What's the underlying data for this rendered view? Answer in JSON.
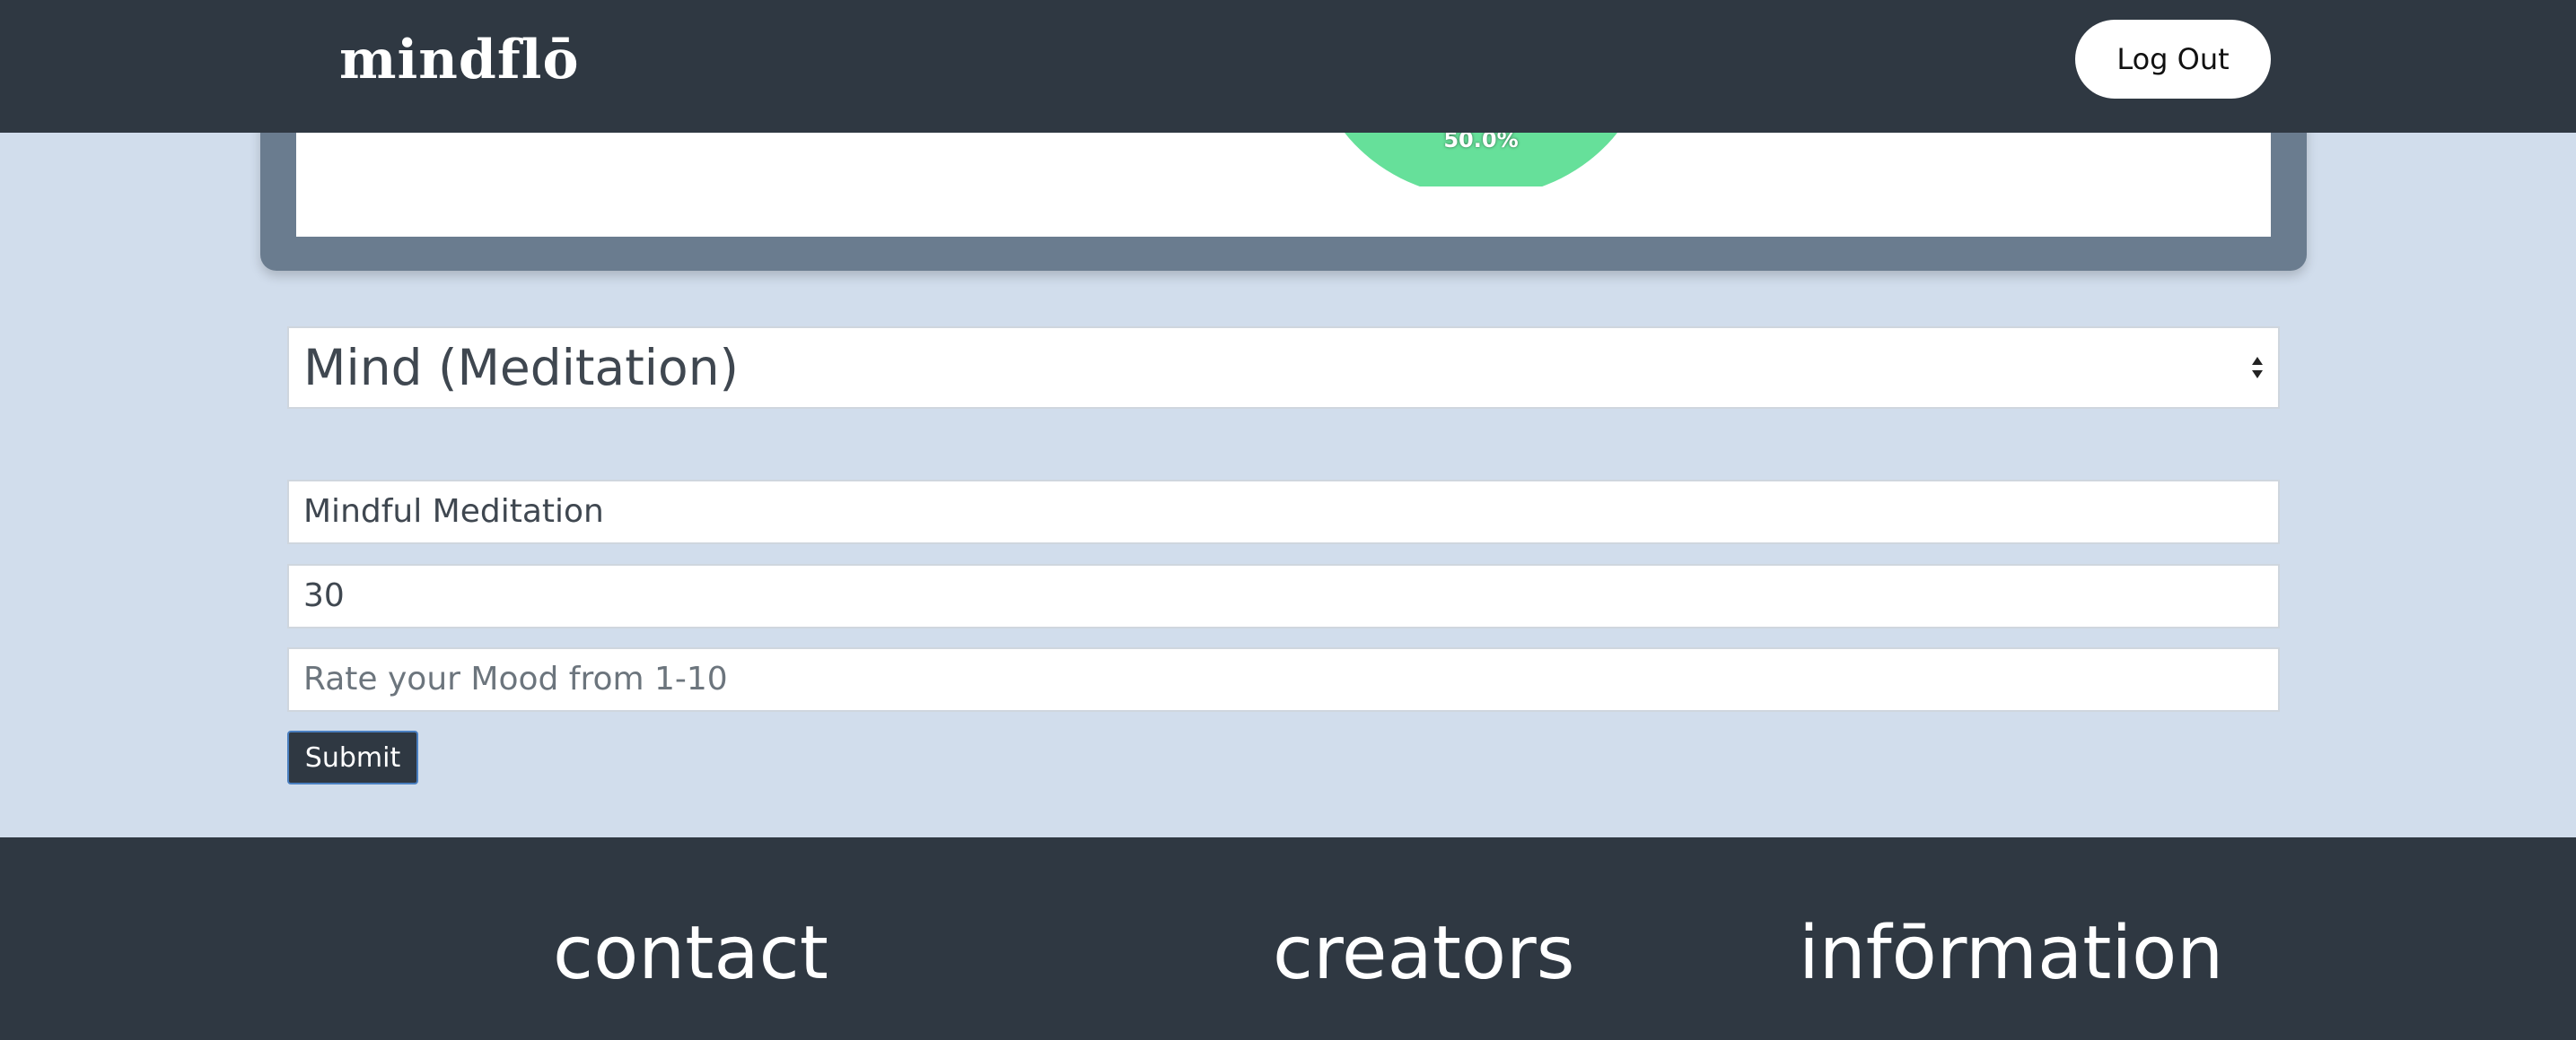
{
  "header": {
    "brand": "mindflō",
    "logout_label": "Log Out"
  },
  "chart_data": {
    "type": "pie",
    "slices": [
      {
        "label": "50.0%",
        "value": 50.0,
        "color": "#66e09a"
      }
    ]
  },
  "form": {
    "category_selected": "Mind (Meditation)",
    "activity_value": "Mindful Meditation",
    "duration_value": "30",
    "mood_placeholder": "Rate your Mood from 1-10",
    "submit_label": "Submit"
  },
  "footer": {
    "headings": [
      "contact",
      "creators",
      "infōrmation"
    ]
  },
  "colors": {
    "navbar": "#2f3842",
    "page_background": "#d1ddec",
    "card_frame": "#6a7c8f",
    "pie_green": "#66e09a"
  }
}
